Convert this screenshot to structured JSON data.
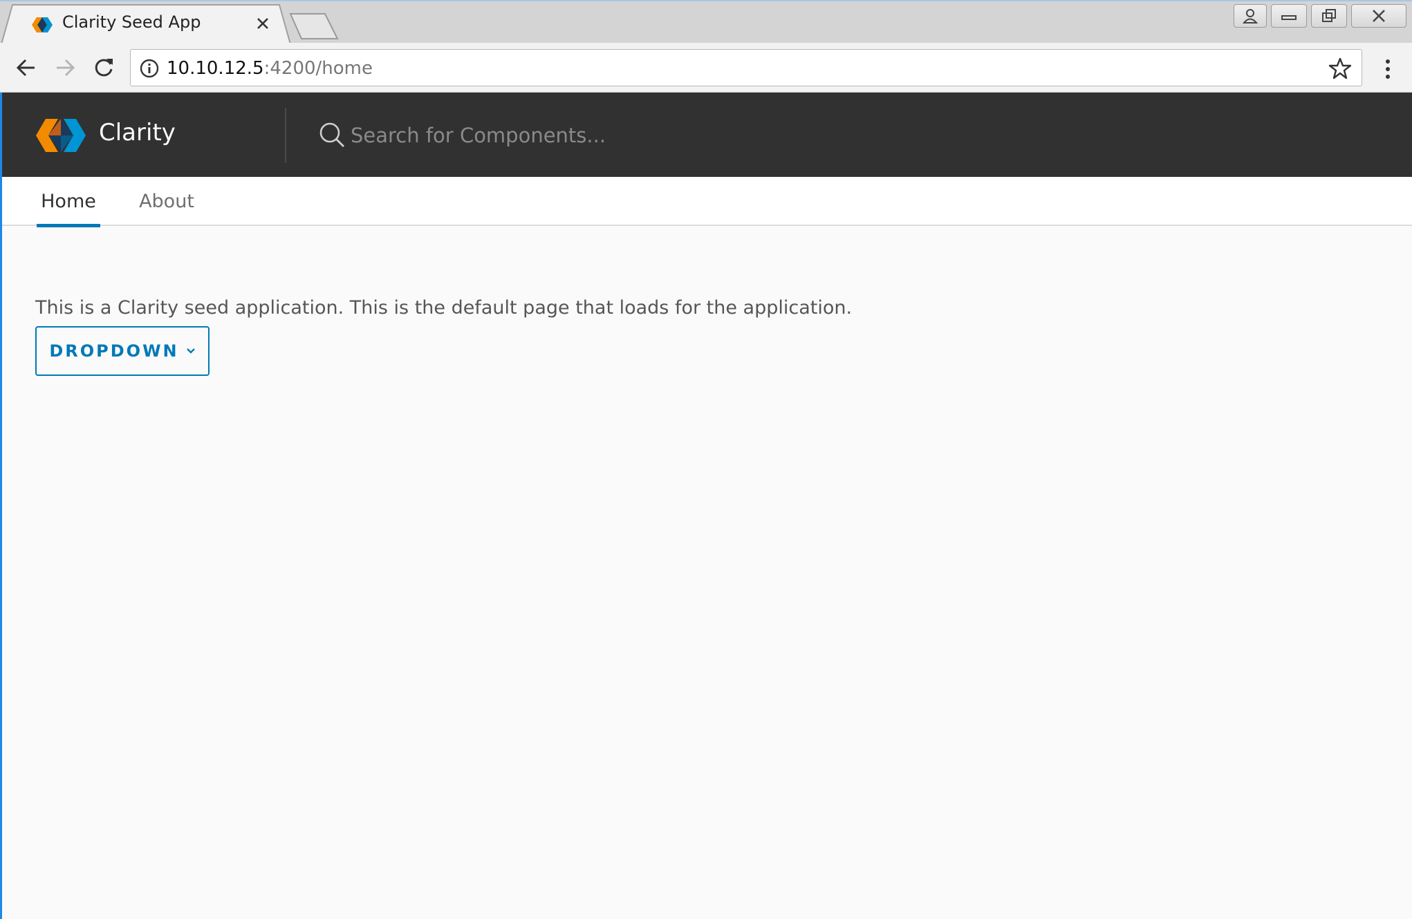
{
  "browser": {
    "tab_title": "Clarity Seed App",
    "url_host": "10.10.12.5",
    "url_path": ":4200/home"
  },
  "icons": {
    "favicon": "clarity-logo-icon",
    "back": "back-arrow-icon",
    "forward": "forward-arrow-icon",
    "reload": "reload-icon",
    "info": "info-icon",
    "star": "bookmark-star-icon",
    "menu": "kebab-menu-icon",
    "search": "search-icon",
    "dropdown_caret": "chevron-down-icon"
  },
  "app": {
    "brand": "Clarity",
    "search_placeholder": "Search for Components...",
    "nav": {
      "tabs": [
        {
          "label": "Home",
          "active": true
        },
        {
          "label": "About",
          "active": false
        }
      ]
    },
    "content": {
      "intro": "This is a Clarity seed application. This is the default page that loads for the application.",
      "dropdown_label": "DROPDOWN"
    }
  },
  "colors": {
    "header_bg": "#313131",
    "accent": "#0079b8",
    "logo_orange": "#f38b00",
    "logo_blue": "#0095d3"
  }
}
